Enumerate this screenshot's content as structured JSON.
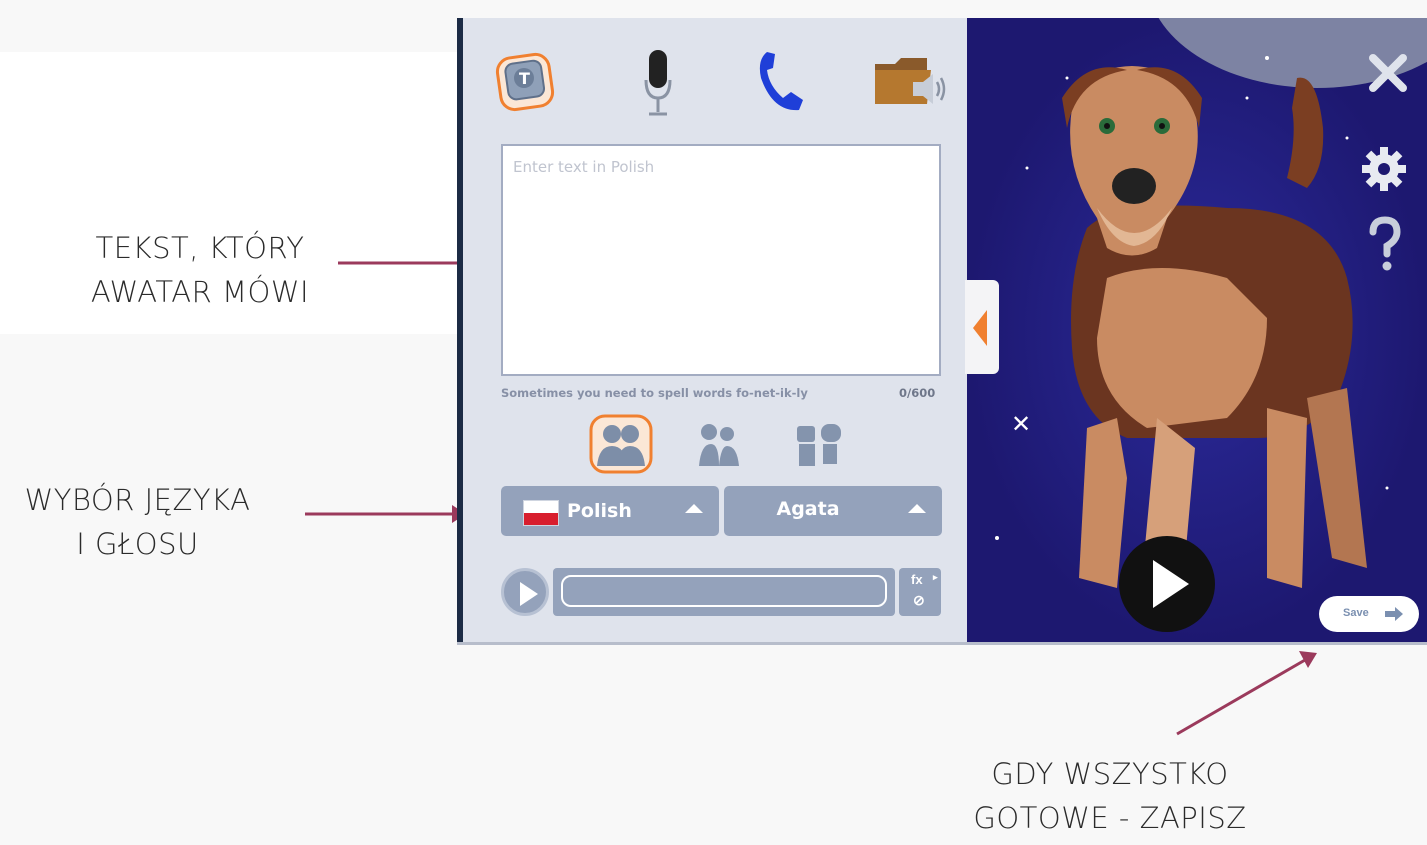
{
  "annotations": {
    "text_input_caption": [
      "TEKST, KTÓRY",
      "AWATAR MÓWI"
    ],
    "language_caption": [
      "WYBÓR JĘZYKA",
      "I GŁOSU"
    ],
    "save_caption": [
      "GDY WSZYSTKO",
      "GOTOWE - ZAPISZ"
    ],
    "arrow_color": "#9b3a5c"
  },
  "editor": {
    "text_placeholder": "Enter text in Polish",
    "hint": "Sometimes you need to spell words fo-net-ik-ly",
    "char_count": "0/600",
    "language": "Polish",
    "voice": "Agata",
    "fx_label": "fx",
    "toolbar_icons": [
      "keyboard-icon",
      "microphone-icon",
      "phone-icon",
      "audio-folder-icon"
    ],
    "voice_types": [
      "adult-voices-icon",
      "kid-voices-icon",
      "robot-voices-icon"
    ]
  },
  "scene": {
    "save_label": "Save",
    "accent_color": "#f08030",
    "background_color": "#1d1870"
  }
}
